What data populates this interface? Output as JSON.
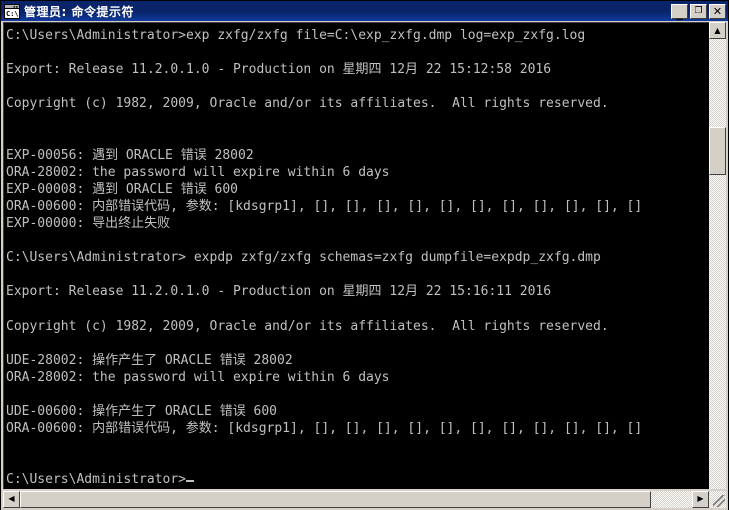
{
  "window": {
    "title": "管理员: 命令提示符",
    "icon": "cmd-icon",
    "icon_label": "C:\\",
    "buttons": {
      "minimize": "_",
      "maximize": "❐",
      "close": "✕"
    }
  },
  "scrollbars": {
    "vertical": {
      "up_arrow": "▲",
      "down_arrow": "▼"
    },
    "horizontal": {
      "left_arrow": "◀",
      "right_arrow": "▶"
    }
  },
  "console": {
    "colors": {
      "background": "#000000",
      "foreground": "#c0c0c0",
      "titlebar": "#0a246a",
      "chrome": "#d4d0c8"
    },
    "cursor": "_",
    "lines": [
      "C:\\Users\\Administrator>exp zxfg/zxfg file=C:\\exp_zxfg.dmp log=exp_zxfg.log",
      "",
      "Export: Release 11.2.0.1.0 - Production on 星期四 12月 22 15:12:58 2016",
      "",
      "Copyright (c) 1982, 2009, Oracle and/or its affiliates.  All rights reserved.",
      "",
      "",
      "EXP-00056: 遇到 ORACLE 错误 28002",
      "ORA-28002: the password will expire within 6 days",
      "EXP-00008: 遇到 ORACLE 错误 600",
      "ORA-00600: 内部错误代码, 参数: [kdsgrp1], [], [], [], [], [], [], [], [], [], [], []",
      "EXP-00000: 导出终止失败",
      "",
      "C:\\Users\\Administrator> expdp zxfg/zxfg schemas=zxfg dumpfile=expdp_zxfg.dmp",
      "",
      "Export: Release 11.2.0.1.0 - Production on 星期四 12月 22 15:16:11 2016",
      "",
      "Copyright (c) 1982, 2009, Oracle and/or its affiliates.  All rights reserved.",
      "",
      "UDE-28002: 操作产生了 ORACLE 错误 28002",
      "ORA-28002: the password will expire within 6 days",
      "",
      "UDE-00600: 操作产生了 ORACLE 错误 600",
      "ORA-00600: 内部错误代码, 参数: [kdsgrp1], [], [], [], [], [], [], [], [], [], [], []",
      "",
      ""
    ],
    "prompt_last": "C:\\Users\\Administrator>"
  }
}
